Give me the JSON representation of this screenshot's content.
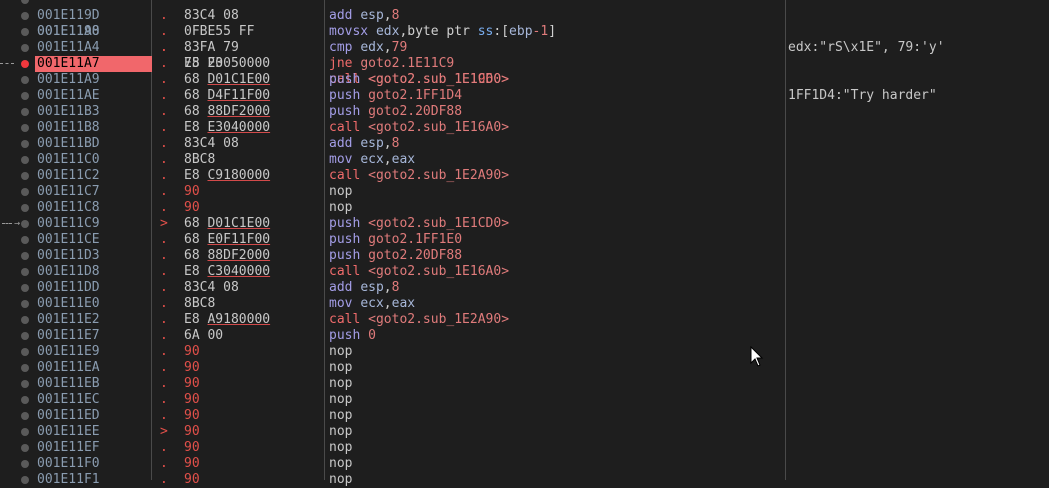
{
  "rows": [
    {
      "addr": "001E119D",
      "bytes": "83C4 08",
      "mnem": "add",
      "op": "esp,8",
      "kind": "add"
    },
    {
      "addr": "001E11A0",
      "bytes": "0FBE55 FF",
      "mnem": "movsx",
      "op": "edx,byte ptr ss:[ebp-1]",
      "kind": "movsx"
    },
    {
      "addr": "001E11A4",
      "bytes": "83FA 79",
      "mnem": "cmp",
      "op": "edx,79",
      "kind": "cmp"
    },
    {
      "addr": "001E11A7",
      "bytes": "75 20",
      "mnem": "jne",
      "op": "goto2.1E11C9",
      "kind": "jmp",
      "selected": true
    },
    {
      "addr": "001E11A9",
      "bytes": "68 D01C1E00",
      "mnem": "push",
      "op": "<goto2.sub_1E1CD0>",
      "kind": "push"
    },
    {
      "addr": "001E11AE",
      "bytes": "68 D4F11F00",
      "mnem": "push",
      "op": "goto2.1FF1D4",
      "kind": "push"
    },
    {
      "addr": "001E11B3",
      "bytes": "68 88DF2000",
      "mnem": "push",
      "op": "goto2.20DF88",
      "kind": "push"
    },
    {
      "addr": "001E11B8",
      "bytes": "E8 E3040000",
      "mnem": "call",
      "op": "<goto2.sub_1E16A0>",
      "kind": "call"
    },
    {
      "addr": "001E11BD",
      "bytes": "83C4 08",
      "mnem": "add",
      "op": "esp,8",
      "kind": "add"
    },
    {
      "addr": "001E11C0",
      "bytes": "8BC8",
      "mnem": "mov",
      "op": "ecx,eax",
      "kind": "mov"
    },
    {
      "addr": "001E11C2",
      "bytes": "E8 C9180000",
      "mnem": "call",
      "op": "<goto2.sub_1E2A90>",
      "kind": "call"
    },
    {
      "addr": "001E11C7",
      "bytes": "90",
      "mnem": "nop",
      "op": "",
      "kind": "nop"
    },
    {
      "addr": "001E11C8",
      "bytes": "90",
      "mnem": "nop",
      "op": "",
      "kind": "nop"
    },
    {
      "addr": "001E11C9",
      "bytes": "68 D01C1E00",
      "mnem": "push",
      "op": "<goto2.sub_1E1CD0>",
      "kind": "push"
    },
    {
      "addr": "001E11CE",
      "bytes": "68 E0F11F00",
      "mnem": "push",
      "op": "goto2.1FF1E0",
      "kind": "push"
    },
    {
      "addr": "001E11D3",
      "bytes": "68 88DF2000",
      "mnem": "push",
      "op": "goto2.20DF88",
      "kind": "push"
    },
    {
      "addr": "001E11D8",
      "bytes": "E8 C3040000",
      "mnem": "call",
      "op": "<goto2.sub_1E16A0>",
      "kind": "call"
    },
    {
      "addr": "001E11DD",
      "bytes": "83C4 08",
      "mnem": "add",
      "op": "esp,8",
      "kind": "add"
    },
    {
      "addr": "001E11E0",
      "bytes": "8BC8",
      "mnem": "mov",
      "op": "ecx,eax",
      "kind": "mov"
    },
    {
      "addr": "001E11E2",
      "bytes": "E8 A9180000",
      "mnem": "call",
      "op": "<goto2.sub_1E2A90>",
      "kind": "call"
    },
    {
      "addr": "001E11E7",
      "bytes": "6A 00",
      "mnem": "push",
      "op": "0",
      "kind": "push"
    },
    {
      "addr": "001E11E9",
      "bytes": "90",
      "mnem": "nop",
      "op": "",
      "kind": "nop"
    },
    {
      "addr": "001E11EA",
      "bytes": "90",
      "mnem": "nop",
      "op": "",
      "kind": "nop"
    },
    {
      "addr": "001E11EB",
      "bytes": "90",
      "mnem": "nop",
      "op": "",
      "kind": "nop"
    },
    {
      "addr": "001E11EC",
      "bytes": "90",
      "mnem": "nop",
      "op": "",
      "kind": "nop"
    },
    {
      "addr": "001E11ED",
      "bytes": "90",
      "mnem": "nop",
      "op": "",
      "kind": "nop"
    },
    {
      "addr": "001E11EE",
      "bytes": "90",
      "mnem": "nop",
      "op": "",
      "kind": "nop"
    },
    {
      "addr": "001E11EF",
      "bytes": "90",
      "mnem": "nop",
      "op": "",
      "kind": "nop"
    },
    {
      "addr": "001E11F0",
      "bytes": "90",
      "mnem": "nop",
      "op": "",
      "kind": "nop"
    },
    {
      "addr": "001E11F1",
      "bytes": "90",
      "mnem": "nop",
      "op": "",
      "kind": "nop"
    }
  ],
  "comments": [
    {
      "row": 2,
      "text": "edx:\"rS\\x1E\", 79:'y'"
    },
    {
      "row": 5,
      "text": "1FF1D4:\"Try harder\""
    }
  ],
  "colors": {
    "selected_bg": "#f1676b",
    "breakpoint": "#f0383d",
    "background": "#1e1e1e"
  }
}
